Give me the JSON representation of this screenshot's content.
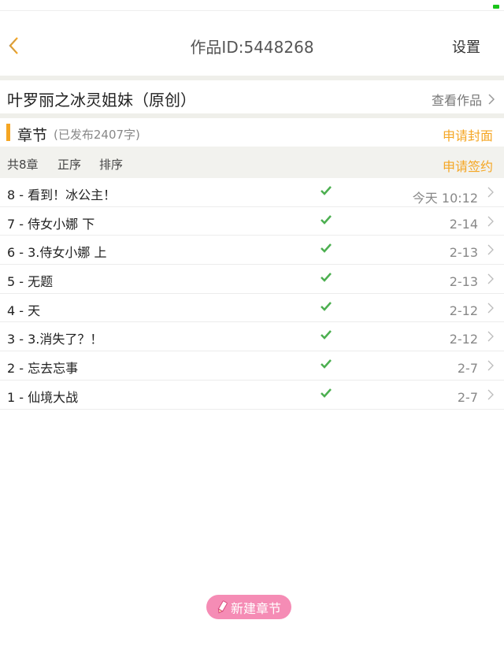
{
  "colors": {
    "accent": "#f5a623",
    "check": "#4caf50",
    "pink": "#f58cb5"
  },
  "header": {
    "back_icon": "chevron-left-icon",
    "title": "作品ID:5448268",
    "settings_label": "设置"
  },
  "work": {
    "title": "叶罗丽之冰灵姐妹（原创）",
    "view_label": "查看作品"
  },
  "chapters_section": {
    "label": "章节",
    "published": "(已发布2407字)",
    "apply_cover": "申请封面"
  },
  "toolbar": {
    "total": "共8章",
    "order": "正序",
    "sort": "排序",
    "apply_sign": "申请签约"
  },
  "chapters": [
    {
      "title": "8 - 看到！冰公主！",
      "date": "今天 10:12"
    },
    {
      "title": "7 - 侍女小娜 下",
      "date": "2-14"
    },
    {
      "title": "6 - 3.侍女小娜 上",
      "date": "2-13"
    },
    {
      "title": "5 - 无题",
      "date": "2-13"
    },
    {
      "title": "4 - 天",
      "date": "2-12"
    },
    {
      "title": "3 - 3.消失了？！",
      "date": "2-12"
    },
    {
      "title": "2 - 忘去忘事",
      "date": "2-7"
    },
    {
      "title": "1 - 仙境大战",
      "date": "2-7"
    }
  ],
  "new_chapter": {
    "label": "新建章节",
    "icon": "pencil-icon"
  }
}
